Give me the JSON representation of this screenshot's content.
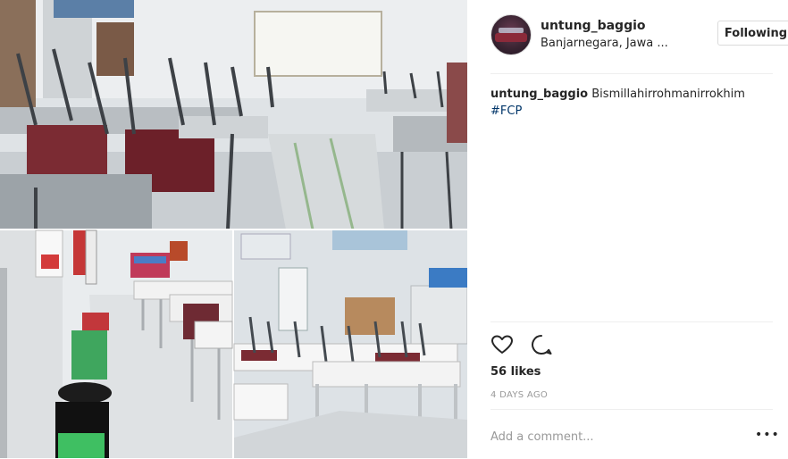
{
  "post": {
    "username": "untung_baggio",
    "location": "Banjarnegara, Jawa ...",
    "follow_label": "Following",
    "caption_user": "untung_baggio",
    "caption_text": "Bismillahirrohmanirrokhim",
    "hashtag": "#FCP",
    "likes": "56 likes",
    "time": "4 DAYS AGO",
    "comment_placeholder": "Add a comment...",
    "more_label": "•••"
  },
  "icons": {
    "like": "heart-icon",
    "comment": "comment-icon",
    "more": "more-options-icon"
  },
  "colors": {
    "link": "#003569",
    "border": "#efefef",
    "muted": "#999999"
  }
}
